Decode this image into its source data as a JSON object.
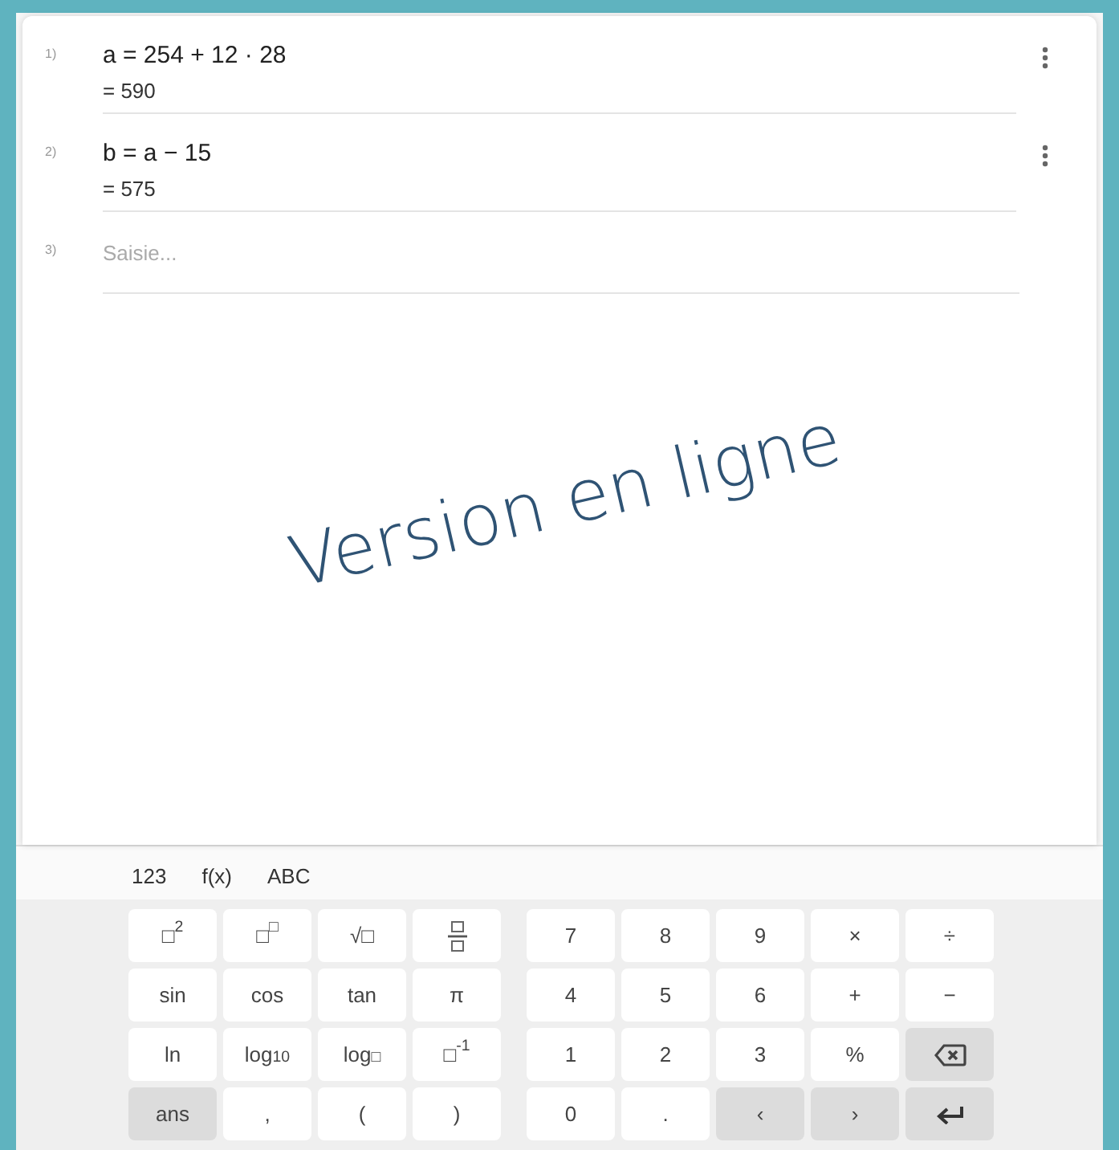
{
  "algebra": {
    "rows": [
      {
        "number": "1)",
        "input": "a = 254 + 12 · 28",
        "output": "= 590",
        "menu": true
      },
      {
        "number": "2)",
        "input": "b = a − 15",
        "output": "= 575",
        "menu": true
      }
    ],
    "entry": {
      "number": "3)",
      "placeholder": "Saisie..."
    }
  },
  "overlay": {
    "text": "Version en ligne"
  },
  "keyboard": {
    "tabs": [
      {
        "label": "123"
      },
      {
        "label": "f(x)"
      },
      {
        "label": "ABC"
      }
    ],
    "left_keys": [
      {
        "kind": "text",
        "label": "□$^{2}$",
        "shaded": false
      },
      {
        "kind": "text",
        "label": "□$^{□}$",
        "shaded": false
      },
      {
        "kind": "text",
        "label": "√□",
        "shaded": false
      },
      {
        "kind": "fraction",
        "shaded": false
      },
      {
        "kind": "text",
        "label": "sin",
        "shaded": false
      },
      {
        "kind": "text",
        "label": "cos",
        "shaded": false
      },
      {
        "kind": "text",
        "label": "tan",
        "shaded": false
      },
      {
        "kind": "text",
        "label": "π",
        "shaded": false
      },
      {
        "kind": "text",
        "label": "ln",
        "shaded": false
      },
      {
        "kind": "text",
        "label": "log$_{10}$",
        "shaded": false
      },
      {
        "kind": "text",
        "label": "log$_{□}$",
        "shaded": false
      },
      {
        "kind": "text",
        "label": "□$^{-1}$",
        "shaded": false
      },
      {
        "kind": "text",
        "label": "ans",
        "shaded": true
      },
      {
        "kind": "text",
        "label": ",",
        "shaded": false
      },
      {
        "kind": "text",
        "label": "(",
        "shaded": false
      },
      {
        "kind": "text",
        "label": ")",
        "shaded": false
      }
    ],
    "right_keys": [
      {
        "kind": "text",
        "label": "7",
        "shaded": false
      },
      {
        "kind": "text",
        "label": "8",
        "shaded": false
      },
      {
        "kind": "text",
        "label": "9",
        "shaded": false
      },
      {
        "kind": "text",
        "label": "×",
        "shaded": false
      },
      {
        "kind": "text",
        "label": "÷",
        "shaded": false
      },
      {
        "kind": "text",
        "label": "4",
        "shaded": false
      },
      {
        "kind": "text",
        "label": "5",
        "shaded": false
      },
      {
        "kind": "text",
        "label": "6",
        "shaded": false
      },
      {
        "kind": "text",
        "label": "+",
        "shaded": false
      },
      {
        "kind": "text",
        "label": "−",
        "shaded": false
      },
      {
        "kind": "text",
        "label": "1",
        "shaded": false
      },
      {
        "kind": "text",
        "label": "2",
        "shaded": false
      },
      {
        "kind": "text",
        "label": "3",
        "shaded": false
      },
      {
        "kind": "text",
        "label": "%",
        "shaded": false
      },
      {
        "kind": "backspace",
        "shaded": true
      },
      {
        "kind": "text",
        "label": "0",
        "shaded": false
      },
      {
        "kind": "text",
        "label": ".",
        "shaded": false
      },
      {
        "kind": "text",
        "label": "‹",
        "shaded": true
      },
      {
        "kind": "text",
        "label": "›",
        "shaded": true
      },
      {
        "kind": "enter",
        "shaded": true
      }
    ]
  }
}
